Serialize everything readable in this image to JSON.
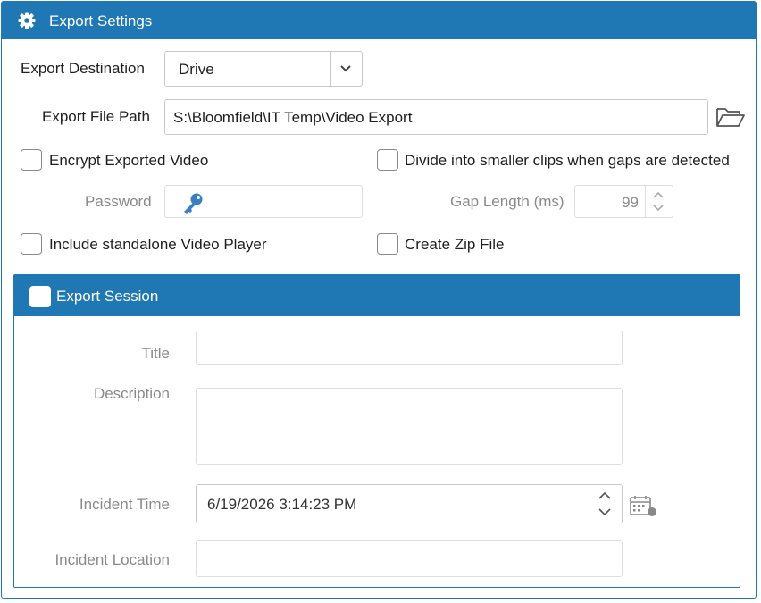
{
  "header": {
    "title": "Export Settings",
    "icon": "gear-icon"
  },
  "destination": {
    "label": "Export Destination",
    "value": "Drive"
  },
  "file_path": {
    "label": "Export File Path",
    "value": "S:\\Bloomfield\\IT Temp\\Video Export"
  },
  "encrypt": {
    "label": "Encrypt Exported Video",
    "checked": false
  },
  "divide": {
    "label": "Divide into smaller clips when gaps are detected",
    "checked": false
  },
  "password": {
    "label": "Password",
    "value": ""
  },
  "gap_length": {
    "label": "Gap Length (ms)",
    "value": "99"
  },
  "standalone": {
    "label": "Include standalone Video Player",
    "checked": false
  },
  "zip": {
    "label": "Create Zip File",
    "checked": false
  },
  "session": {
    "header": "Export Session",
    "checked": false,
    "title_label": "Title",
    "title_value": "",
    "description_label": "Description",
    "description_value": "",
    "incident_time_label": "Incident Time",
    "incident_time_value": "6/19/2026 3:14:23 PM",
    "incident_location_label": "Incident Location",
    "incident_location_value": ""
  },
  "colors": {
    "accent": "#1f78b4",
    "key": "#3a7fc2"
  }
}
